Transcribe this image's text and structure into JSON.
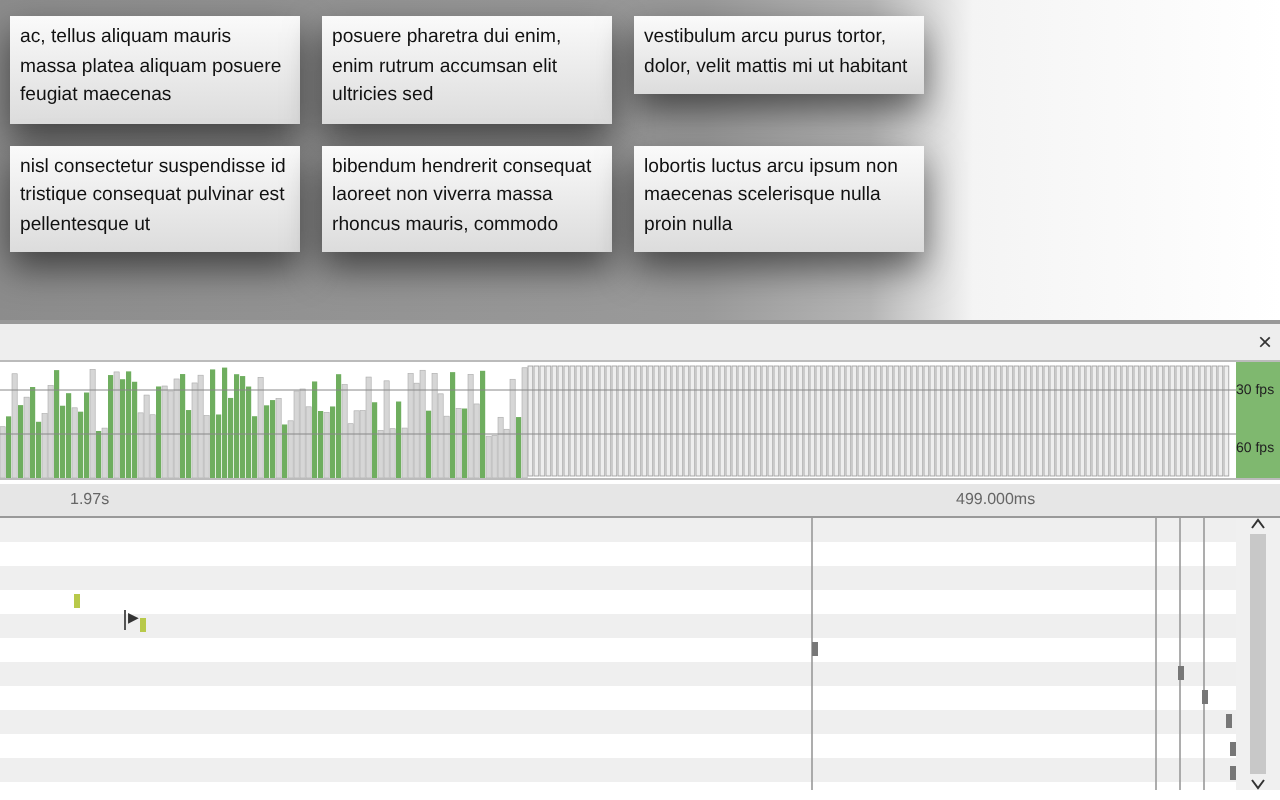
{
  "cards": [
    {
      "text": "ac, tellus aliquam mauris massa platea aliquam posuere feugiat maecenas"
    },
    {
      "text": "posuere pharetra dui enim, enim rutrum accumsan elit ultricies sed"
    },
    {
      "text": "vestibulum arcu purus tortor, dolor, velit mattis mi ut habitant"
    },
    {
      "text": "nisl consectetur suspendisse id tristique consequat pulvinar est pellentesque ut"
    },
    {
      "text": "bibendum hendrerit consequat laoreet non viverra massa rhoncus mauris, commodo"
    },
    {
      "text": "lobortis luctus arcu ipsum non maecenas scelerisque nulla proin nulla"
    }
  ],
  "toolbar": {
    "close": "×"
  },
  "frames": {
    "fps_labels": [
      "30 fps",
      "60 fps"
    ]
  },
  "timeline": {
    "ruler": [
      "1.97s",
      "499.000ms"
    ],
    "expand": "▶"
  }
}
